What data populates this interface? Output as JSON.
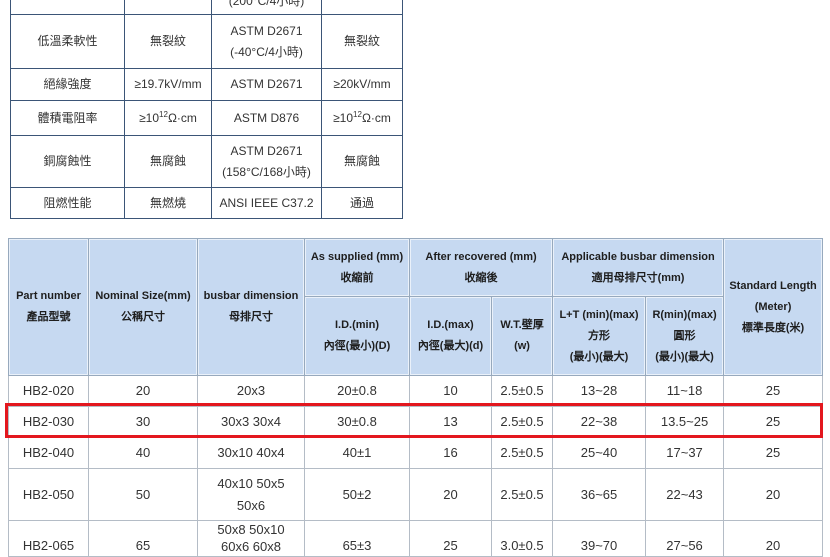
{
  "colors": {
    "props_border": "#3b5577",
    "spec_header_bg": "#c6d9f1",
    "spec_header_border": "#97a9bd",
    "spec_cell_border": "#b4bcc6",
    "highlight": "#e3171e",
    "text": "#333333"
  },
  "properties_table": {
    "partial_row": {
      "method": "(200°C/4小時)"
    },
    "rows": [
      {
        "property": "低溫柔軟性",
        "standard": "無裂紋",
        "method": [
          "ASTM D2671",
          "(-40°C/4小時)"
        ],
        "result": "無裂紋"
      },
      {
        "property": "絕緣強度",
        "standard": "≥19.7kV/mm",
        "method": [
          "ASTM D2671"
        ],
        "result": "≥20kV/mm"
      },
      {
        "property": "體積電阻率",
        "standard": {
          "base": "≥10",
          "exp": "12",
          "unit": "Ω·cm"
        },
        "method": [
          "ASTM D876"
        ],
        "result": {
          "base": "≥10",
          "exp": "12",
          "unit": "Ω·cm"
        }
      },
      {
        "property": "銅腐蝕性",
        "standard": "無腐蝕",
        "method": [
          "ASTM D2671",
          "(158°C/168小時)"
        ],
        "result": "無腐蝕"
      },
      {
        "property": "阻燃性能",
        "standard": "無燃燒",
        "method": [
          "ANSI IEEE C37.2"
        ],
        "result": "通過"
      }
    ]
  },
  "spec_table": {
    "headers": {
      "part_number": [
        "Part number",
        "產品型號"
      ],
      "nominal_size": [
        "Nominal Size(mm)",
        "公稱尺寸"
      ],
      "busbar_dimension": [
        "busbar dimension",
        "母排尺寸"
      ],
      "as_supplied": [
        "As supplied (mm)",
        "收縮前"
      ],
      "after_recovered": [
        "After recovered (mm)",
        "收縮後"
      ],
      "applicable_busbar": [
        "Applicable busbar dimension",
        "適用母排尺寸(mm)"
      ],
      "standard_length": [
        "Standard Length",
        "(Meter)",
        "標準長度(米)"
      ],
      "id_min": [
        "I.D.(min)",
        "內徑(最小)(D)"
      ],
      "id_max": [
        "I.D.(max)",
        "內徑(最大)(d)"
      ],
      "wall_thickness": [
        "W.T.壁厚",
        "(w)"
      ],
      "square": [
        "L+T (min)(max)",
        "方形",
        "(最小)(最大)"
      ],
      "round": [
        "R(min)(max)",
        "圓形",
        "(最小)(最大)"
      ]
    },
    "rows": [
      {
        "part": "HB2-020",
        "nominal": "20",
        "busbar": [
          "20x3"
        ],
        "id_min": "20±0.8",
        "id_max": "10",
        "wt": "2.5±0.5",
        "square": "13~28",
        "round": "11~18",
        "length": "25"
      },
      {
        "part": "HB2-030",
        "nominal": "30",
        "busbar": [
          "30x3 30x4"
        ],
        "id_min": "30±0.8",
        "id_max": "13",
        "wt": "2.5±0.5",
        "square": "22~38",
        "round": "13.5~25",
        "length": "25"
      },
      {
        "part": "HB2-040",
        "nominal": "40",
        "busbar": [
          "30x10 40x4"
        ],
        "id_min": "40±1",
        "id_max": "16",
        "wt": "2.5±0.5",
        "square": "25~40",
        "round": "17~37",
        "length": "25"
      },
      {
        "part": "HB2-050",
        "nominal": "50",
        "busbar": [
          "40x10 50x5",
          "50x6"
        ],
        "id_min": "50±2",
        "id_max": "20",
        "wt": "2.5±0.5",
        "square": "36~65",
        "round": "22~43",
        "length": "20"
      },
      {
        "part": "HB2-065",
        "nominal": "65",
        "busbar": [
          "50x8 50x10",
          "60x6 60x8"
        ],
        "id_min": "65±3",
        "id_max": "25",
        "wt": "3.0±0.5",
        "square": "39~70",
        "round": "27~56",
        "length": "20"
      }
    ]
  }
}
